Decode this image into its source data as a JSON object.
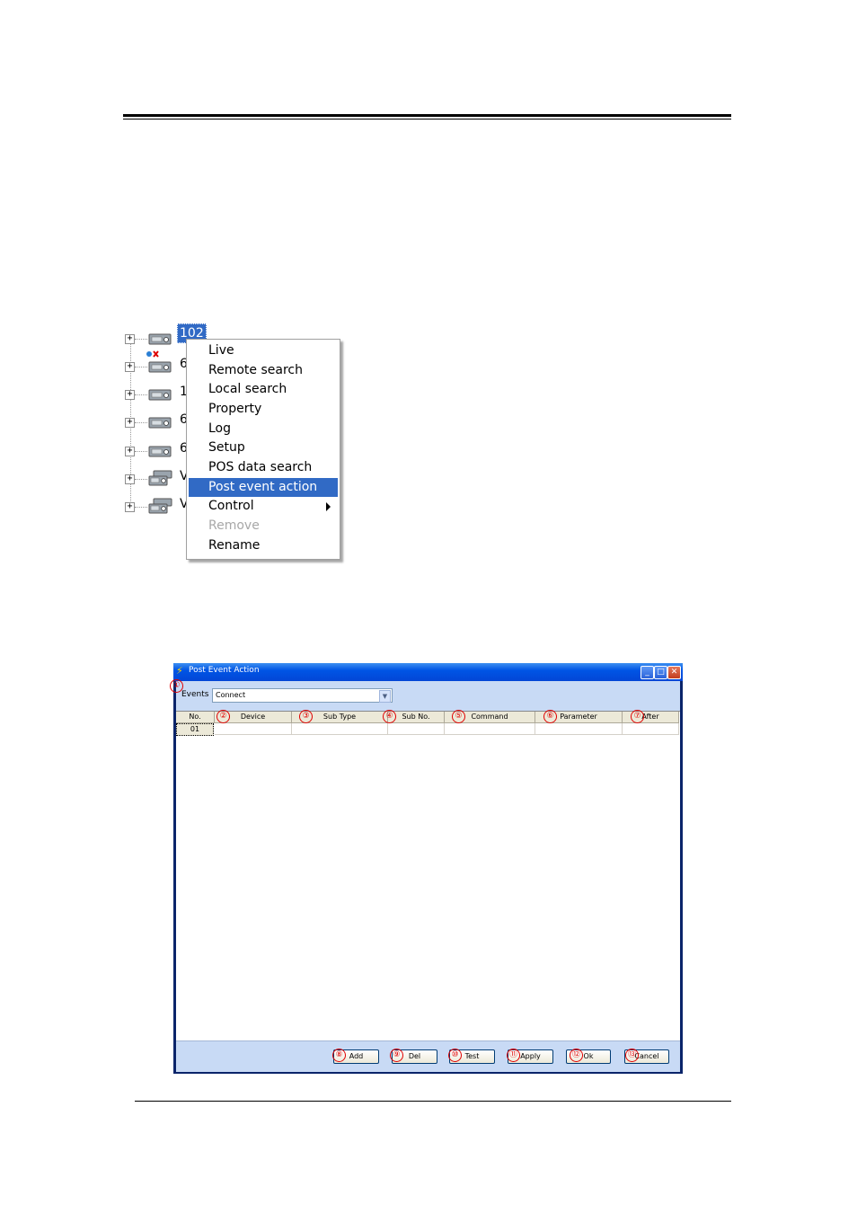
{
  "tree": {
    "items": [
      {
        "label": "102",
        "selected": true
      },
      {
        "label": "6"
      },
      {
        "label": "1"
      },
      {
        "label": "6"
      },
      {
        "label": "6"
      },
      {
        "label": "V"
      },
      {
        "label": "V"
      }
    ],
    "expander_glyph": "+",
    "icons": {
      "device": "dvr-icon",
      "disconnected": "disconnected-icon"
    }
  },
  "context_menu": {
    "items": [
      {
        "label": "Live"
      },
      {
        "label": "Remote search"
      },
      {
        "label": "Local search"
      },
      {
        "label": "Property"
      },
      {
        "label": "Log"
      },
      {
        "label": "Setup"
      },
      {
        "label": "POS data search"
      },
      {
        "label": "Post event action",
        "highlighted": true
      },
      {
        "label": "Control",
        "submenu": true
      },
      {
        "label": "Remove",
        "disabled": true
      },
      {
        "label": "Rename"
      }
    ]
  },
  "dialog": {
    "title": "Post Event Action",
    "title_icon": "lightning-icon",
    "events_label": "Events",
    "events_value": "Connect",
    "columns": [
      "No.",
      "Device",
      "Sub Type",
      "Sub No.",
      "Command",
      "Parameter",
      "After"
    ],
    "rows": [
      [
        "01",
        "",
        "",
        "",
        "",
        "",
        ""
      ]
    ],
    "buttons": {
      "add": "Add",
      "del": "Del",
      "test": "Test",
      "apply": "Apply",
      "ok": "Ok",
      "cancel": "Cancel"
    },
    "callouts": [
      "①",
      "②",
      "③",
      "④",
      "⑤",
      "⑥",
      "⑦",
      "⑧",
      "⑨",
      "⑩",
      "⑪",
      "⑫",
      "⑬"
    ],
    "window_buttons": {
      "minimize": "_",
      "maximize": "□",
      "close": "✕"
    }
  },
  "colors": {
    "selection": "#316ac5",
    "callout": "#e00000",
    "titlebar": "#0055e5"
  }
}
